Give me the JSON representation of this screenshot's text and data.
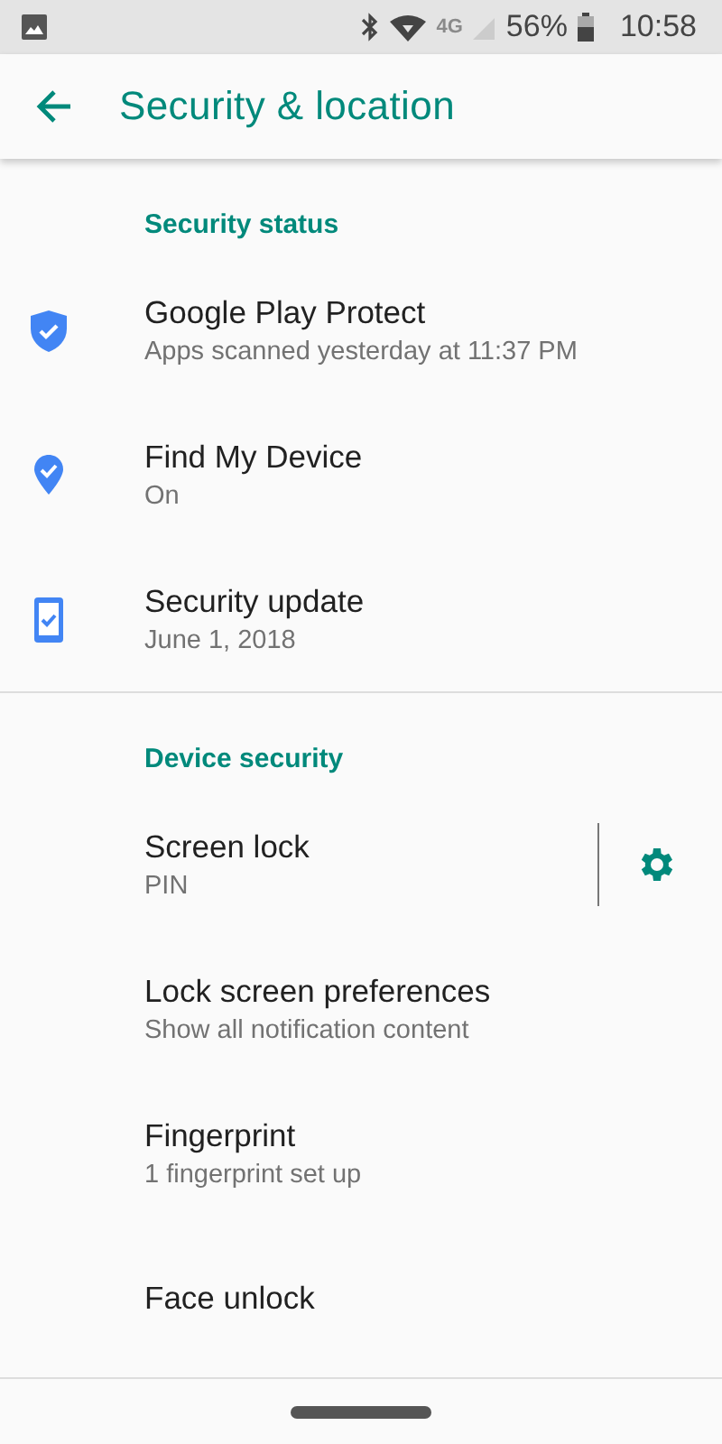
{
  "status_bar": {
    "network": "4G",
    "battery": "56%",
    "time": "10:58"
  },
  "app_bar": {
    "title": "Security & location"
  },
  "sections": [
    {
      "header": "Security status",
      "items": [
        {
          "title": "Google Play Protect",
          "subtitle": "Apps scanned yesterday at 11:37 PM",
          "kind": "shield"
        },
        {
          "title": "Find My Device",
          "subtitle": "On",
          "kind": "pin"
        },
        {
          "title": "Security update",
          "subtitle": "June 1, 2018",
          "kind": "phone"
        }
      ]
    },
    {
      "header": "Device security",
      "items": [
        {
          "title": "Screen lock",
          "subtitle": "PIN",
          "kind": "settings"
        },
        {
          "title": "Lock screen preferences",
          "subtitle": "Show all notification content",
          "kind": "plain"
        },
        {
          "title": "Fingerprint",
          "subtitle": "1 fingerprint set up",
          "kind": "plain"
        },
        {
          "title": "Face unlock",
          "kind": "plain"
        }
      ]
    }
  ]
}
